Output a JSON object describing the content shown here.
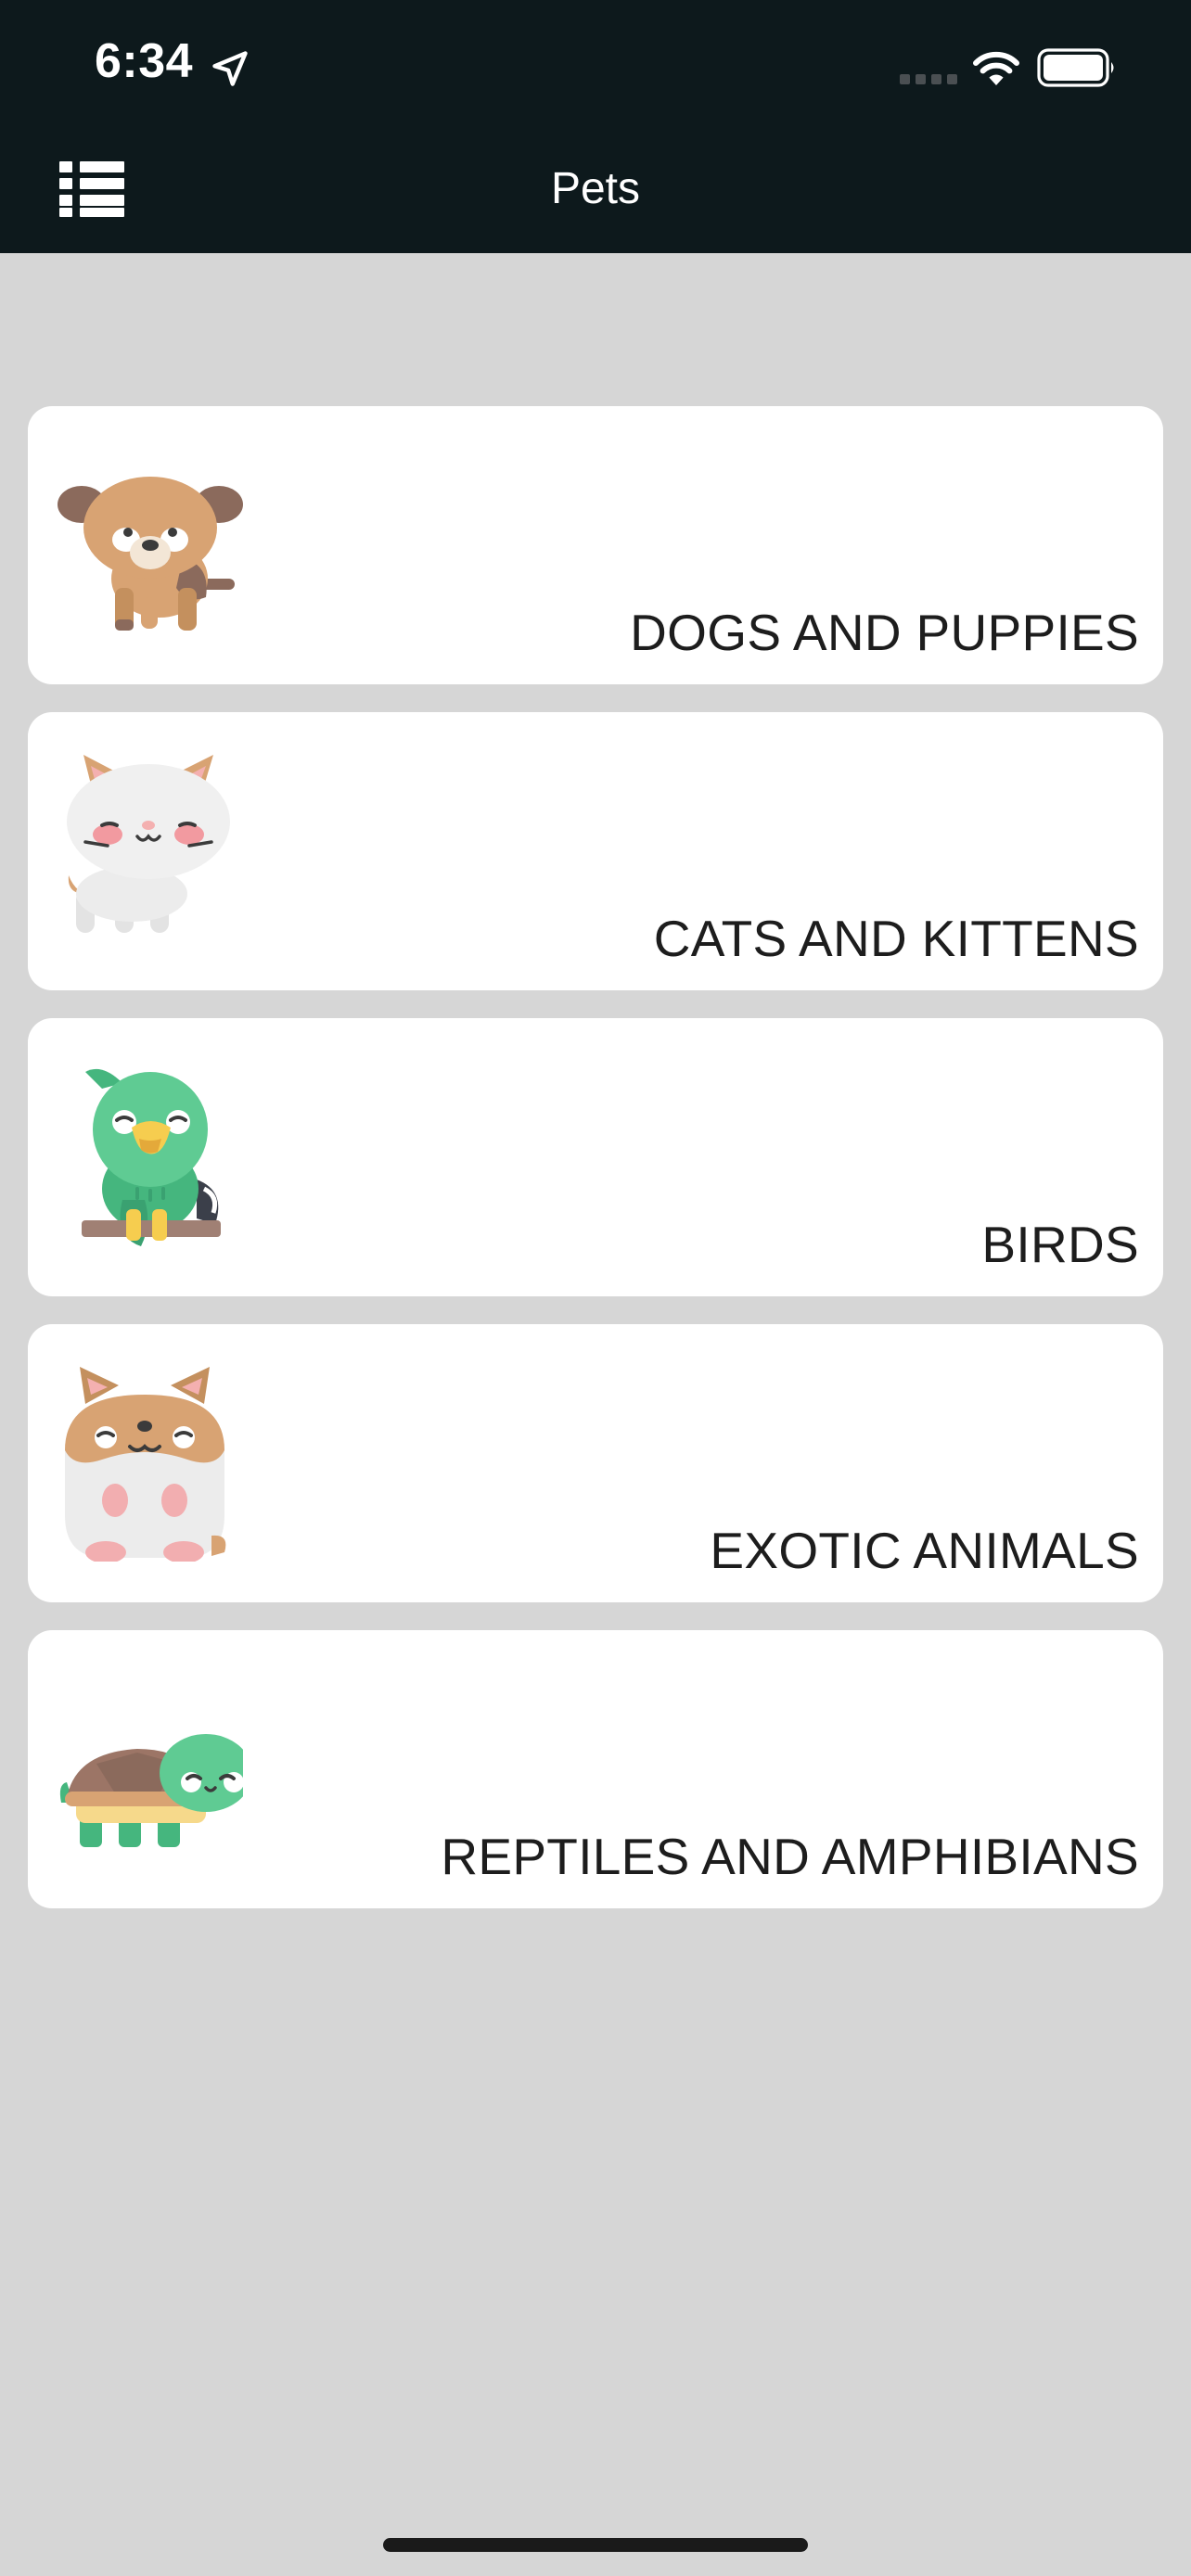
{
  "status_bar": {
    "time": "6:34",
    "icons": [
      "location-arrow-icon",
      "cellular-signal-icon",
      "wifi-icon",
      "battery-icon"
    ]
  },
  "nav": {
    "title": "Pets",
    "menu_icon": "list-menu-icon"
  },
  "categories": [
    {
      "label": "DOGS AND PUPPIES",
      "icon": "dog-icon"
    },
    {
      "label": "CATS AND KITTENS",
      "icon": "cat-icon"
    },
    {
      "label": "BIRDS",
      "icon": "parrot-icon"
    },
    {
      "label": "EXOTIC ANIMALS",
      "icon": "hamster-icon"
    },
    {
      "label": "REPTILES AND AMPHIBIANS",
      "icon": "turtle-icon"
    }
  ],
  "colors": {
    "header_bg": "#0d191c",
    "page_bg": "#d6d6d6",
    "card_bg": "#ffffff",
    "label_text": "#1d1d1d"
  }
}
